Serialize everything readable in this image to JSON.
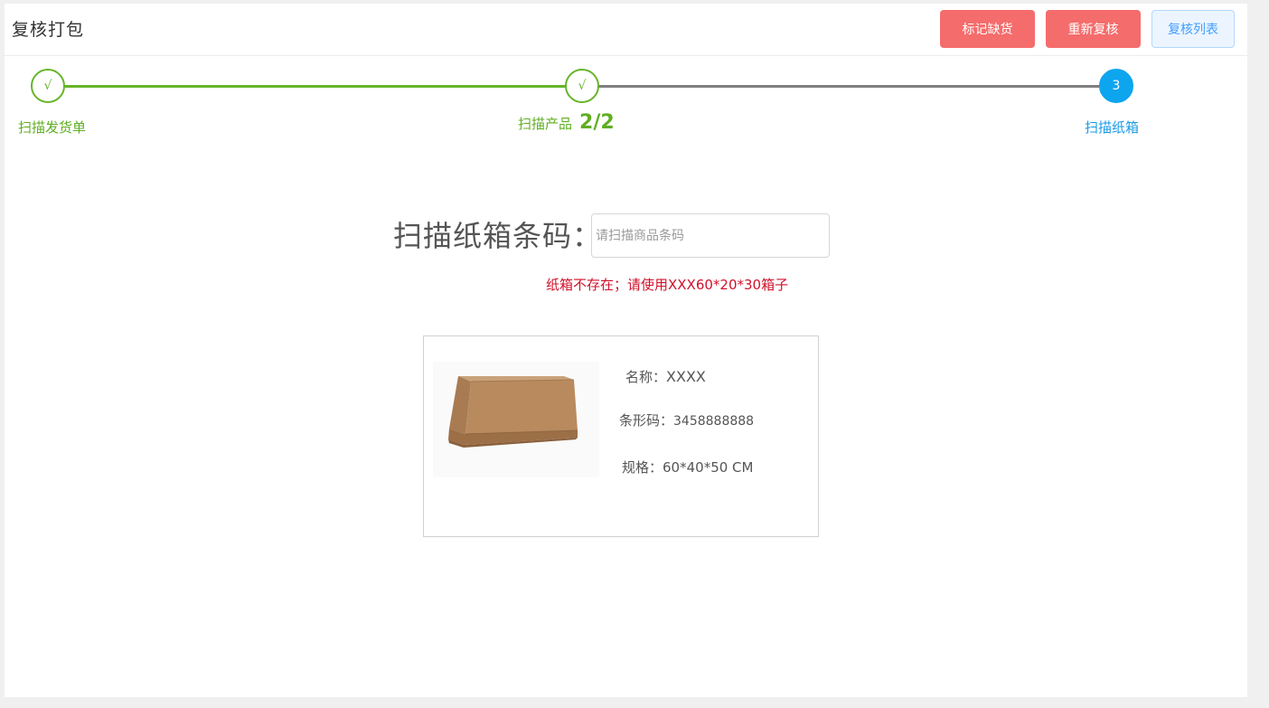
{
  "header": {
    "title": "复核打包",
    "buttons": {
      "mark_shortage": "标记缺货",
      "recheck": "重新复核",
      "check_list": "复核列表"
    }
  },
  "steps": [
    {
      "index": "√",
      "label": "扫描发货单",
      "status": "done"
    },
    {
      "index": "√",
      "label": "扫描产品",
      "count": "2/2",
      "status": "done"
    },
    {
      "index": "3",
      "label": "扫描纸箱",
      "status": "active"
    }
  ],
  "scan": {
    "label": "扫描纸箱条码：",
    "placeholder": "请扫描商品条码",
    "value": "",
    "error": "纸箱不存在；请使用XXX60*20*30箱子"
  },
  "box": {
    "image_icon": "cardboard-box-image",
    "name_label": "名称：",
    "name_value": "XXXX",
    "barcode_label": "条形码：",
    "barcode_value": "3458888888",
    "spec_label": "规格：",
    "spec_value": "60*40*50 CM"
  },
  "colors": {
    "done": "#5fae22",
    "active": "#0ea5ef",
    "danger": "#f56c6c",
    "error_text": "#d0112b",
    "primary_light": "#409eff"
  }
}
